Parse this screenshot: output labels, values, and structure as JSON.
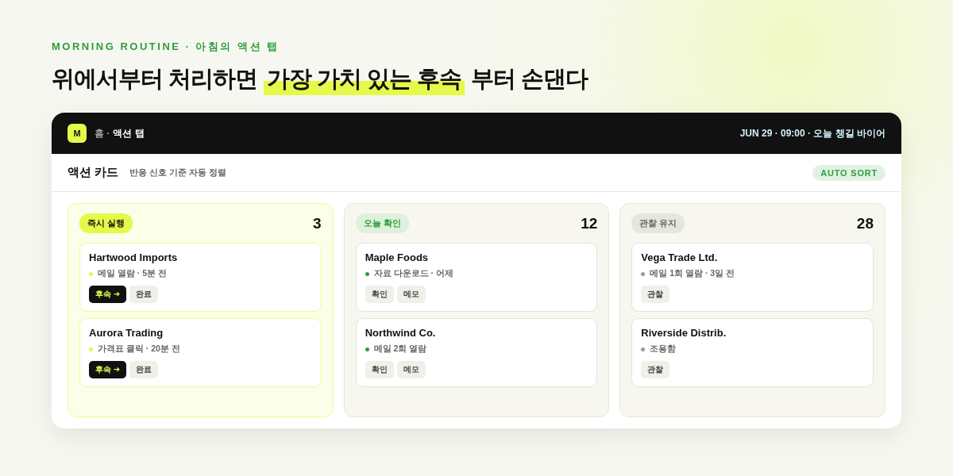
{
  "eyebrow": "MORNING ROUTINE · 아침의 액션 탭",
  "headline": {
    "before": "위에서부터 처리하면",
    "highlight": "가장 가치 있는 후속",
    "after": "부터 손댄다"
  },
  "topbar": {
    "logo": "M",
    "breadcrumb_parent": "홈 ·",
    "breadcrumb_current": "액션 탭",
    "status": "JUN 29 · 09:00 · 오늘 챙길 바이어"
  },
  "subheader": {
    "title": "액션 카드",
    "subtitle": "반응 신호 기준 자동 정렬",
    "badge": "AUTO SORT"
  },
  "columns": [
    {
      "kind": "now",
      "label": "즉시 실행",
      "count": "3",
      "cards": [
        {
          "name": "Hartwood Imports",
          "signal": "메일 열람 · 5분 전",
          "color": "#e4f94a",
          "actions": [
            {
              "kind": "primary",
              "label": "후속 ➜"
            },
            {
              "kind": "plain",
              "label": "완료"
            }
          ]
        },
        {
          "name": "Aurora Trading",
          "signal": "가격표 클릭 · 20분 전",
          "color": "#e4f94a",
          "actions": [
            {
              "kind": "primary",
              "label": "후속 ➜"
            },
            {
              "kind": "plain",
              "label": "완료"
            }
          ]
        }
      ]
    },
    {
      "kind": "today",
      "label": "오늘 확인",
      "count": "12",
      "cards": [
        {
          "name": "Maple Foods",
          "signal": "자료 다운로드 · 어제",
          "color": "#2e9e3e",
          "actions": [
            {
              "kind": "plain",
              "label": "확인"
            },
            {
              "kind": "plain",
              "label": "메모"
            }
          ]
        },
        {
          "name": "Northwind Co.",
          "signal": "메일 2회 열람",
          "color": "#2e9e3e",
          "actions": [
            {
              "kind": "plain",
              "label": "확인"
            },
            {
              "kind": "plain",
              "label": "메모"
            }
          ]
        }
      ]
    },
    {
      "kind": "watch",
      "label": "관찰 유지",
      "count": "28",
      "cards": [
        {
          "name": "Vega Trade Ltd.",
          "signal": "메일 1회 열람 · 3일 전",
          "color": "#9a9a94",
          "actions": [
            {
              "kind": "plain",
              "label": "관찰"
            }
          ]
        },
        {
          "name": "Riverside Distrib.",
          "signal": "조용함",
          "color": "#9a9a94",
          "actions": [
            {
              "kind": "plain",
              "label": "관찰"
            }
          ]
        }
      ]
    }
  ]
}
